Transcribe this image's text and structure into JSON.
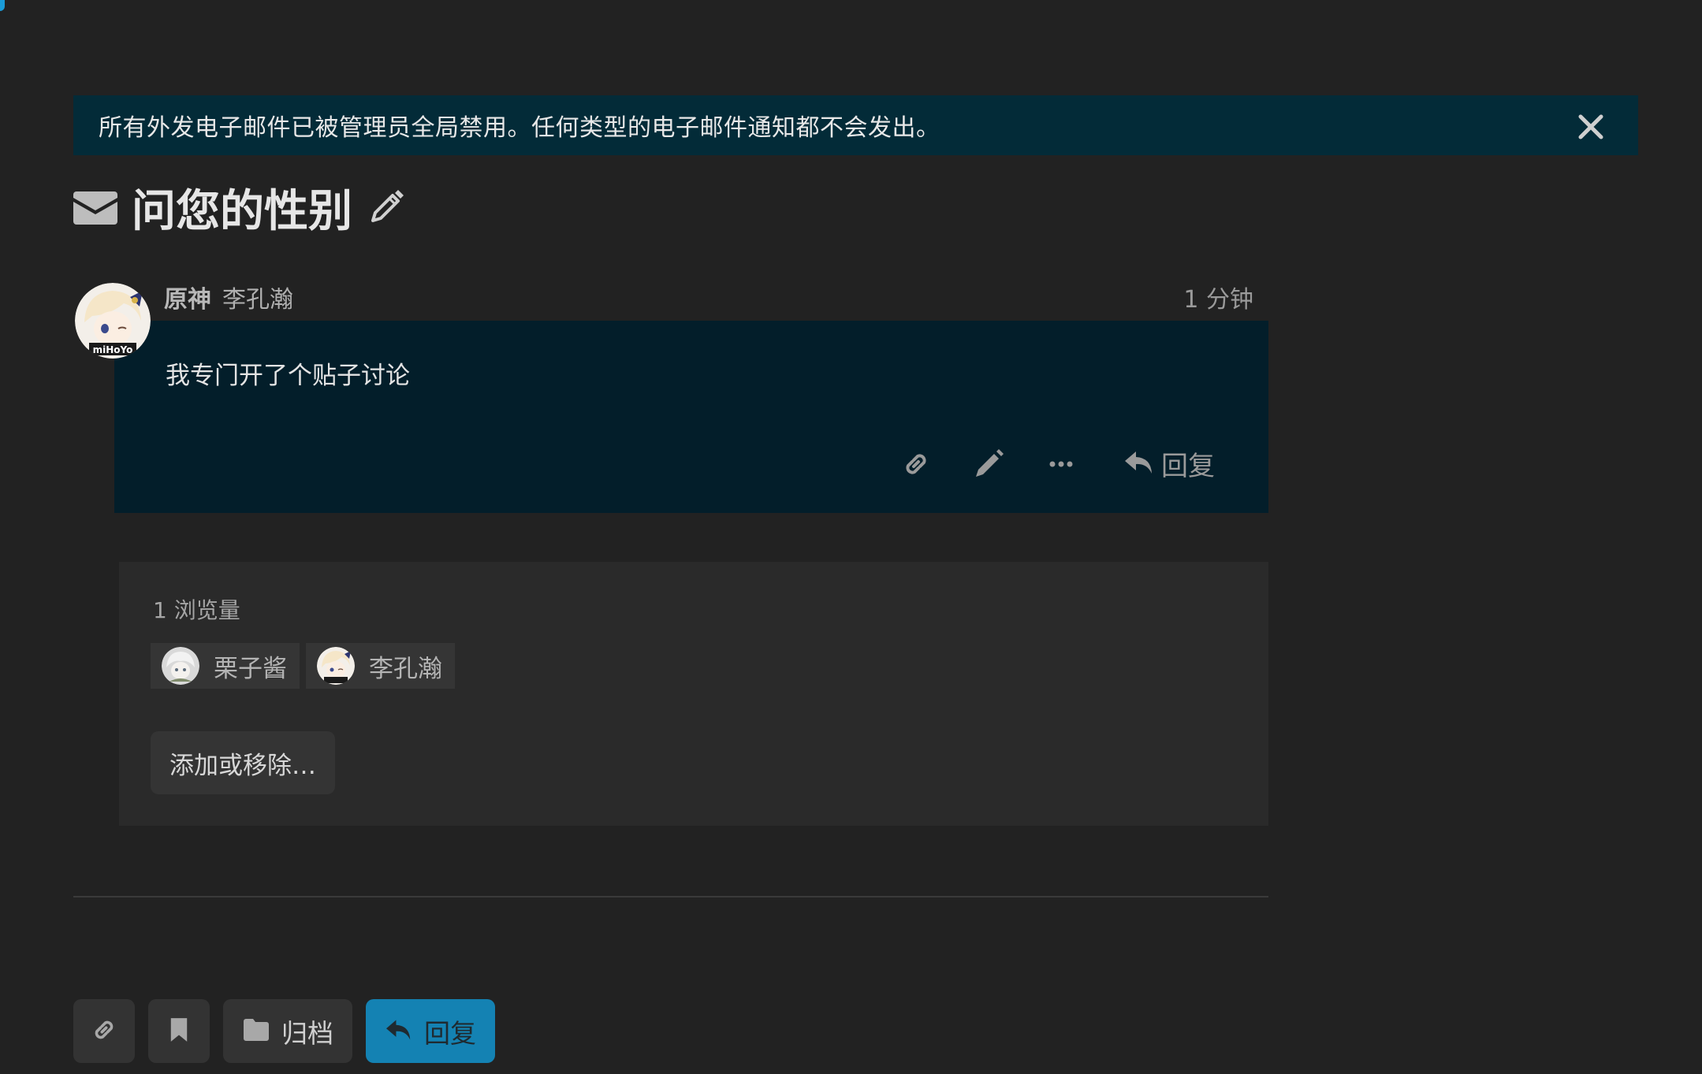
{
  "banner": {
    "text": "所有外发电子邮件已被管理员全局禁用。任何类型的电子邮件通知都不会发出。",
    "close_icon": "close-icon"
  },
  "topic": {
    "title": "问您的性别",
    "type_icon": "envelope-icon",
    "edit_icon": "pencil-icon"
  },
  "post": {
    "username": "原神",
    "full_name": "李孔瀚",
    "time_ago": "1 分钟",
    "content": "我专门开了个贴子讨论",
    "actions": {
      "link_icon": "link-icon",
      "edit_icon": "pencil-icon",
      "more_icon": "ellipsis-icon",
      "reply_label": "回复"
    }
  },
  "participants": {
    "views_label": "1 浏览量",
    "users": [
      {
        "name": "栗子酱"
      },
      {
        "name": "李孔瀚"
      }
    ],
    "add_remove_label": "添加或移除…"
  },
  "footer": {
    "archive_label": "归档",
    "reply_label": "回复"
  },
  "colors": {
    "background": "#222222",
    "banner": "#032b38",
    "post_body": "#031e2a",
    "primary": "#1482b3"
  }
}
